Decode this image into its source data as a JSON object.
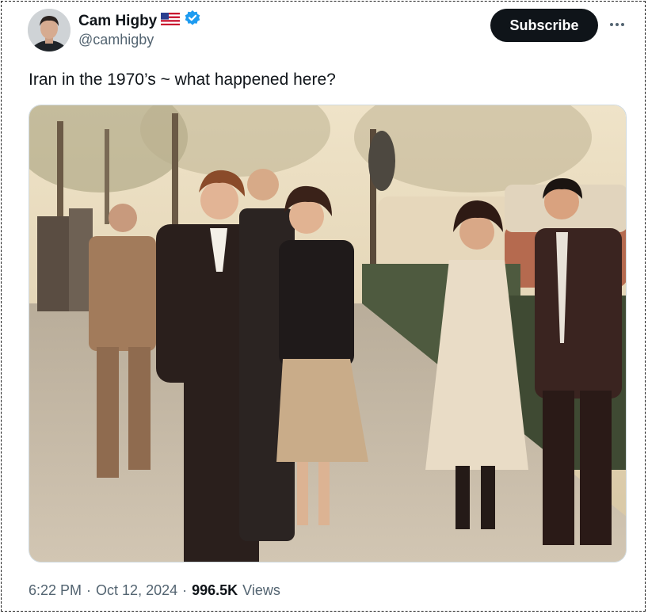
{
  "author": {
    "display_name": "Cam Higby",
    "handle": "@camhigby",
    "flag_icon": "us-flag-icon",
    "verified_icon": "verified-badge-icon",
    "verified_color": "#1d9bf0"
  },
  "actions": {
    "subscribe_label": "Subscribe",
    "more_icon": "more-horizontal-icon"
  },
  "tweet": {
    "text": "Iran in the 1970’s ~ what happened here?"
  },
  "media": {
    "alt": "Vintage sepia-toned photo of people standing on a tree-lined sidewalk"
  },
  "meta": {
    "time": "6:22 PM",
    "separator": "·",
    "date": "Oct 12, 2024",
    "views_count": "996.5K",
    "views_label": "Views"
  },
  "colors": {
    "text_primary": "#0f1419",
    "text_secondary": "#536471",
    "button_bg": "#0f1419"
  }
}
